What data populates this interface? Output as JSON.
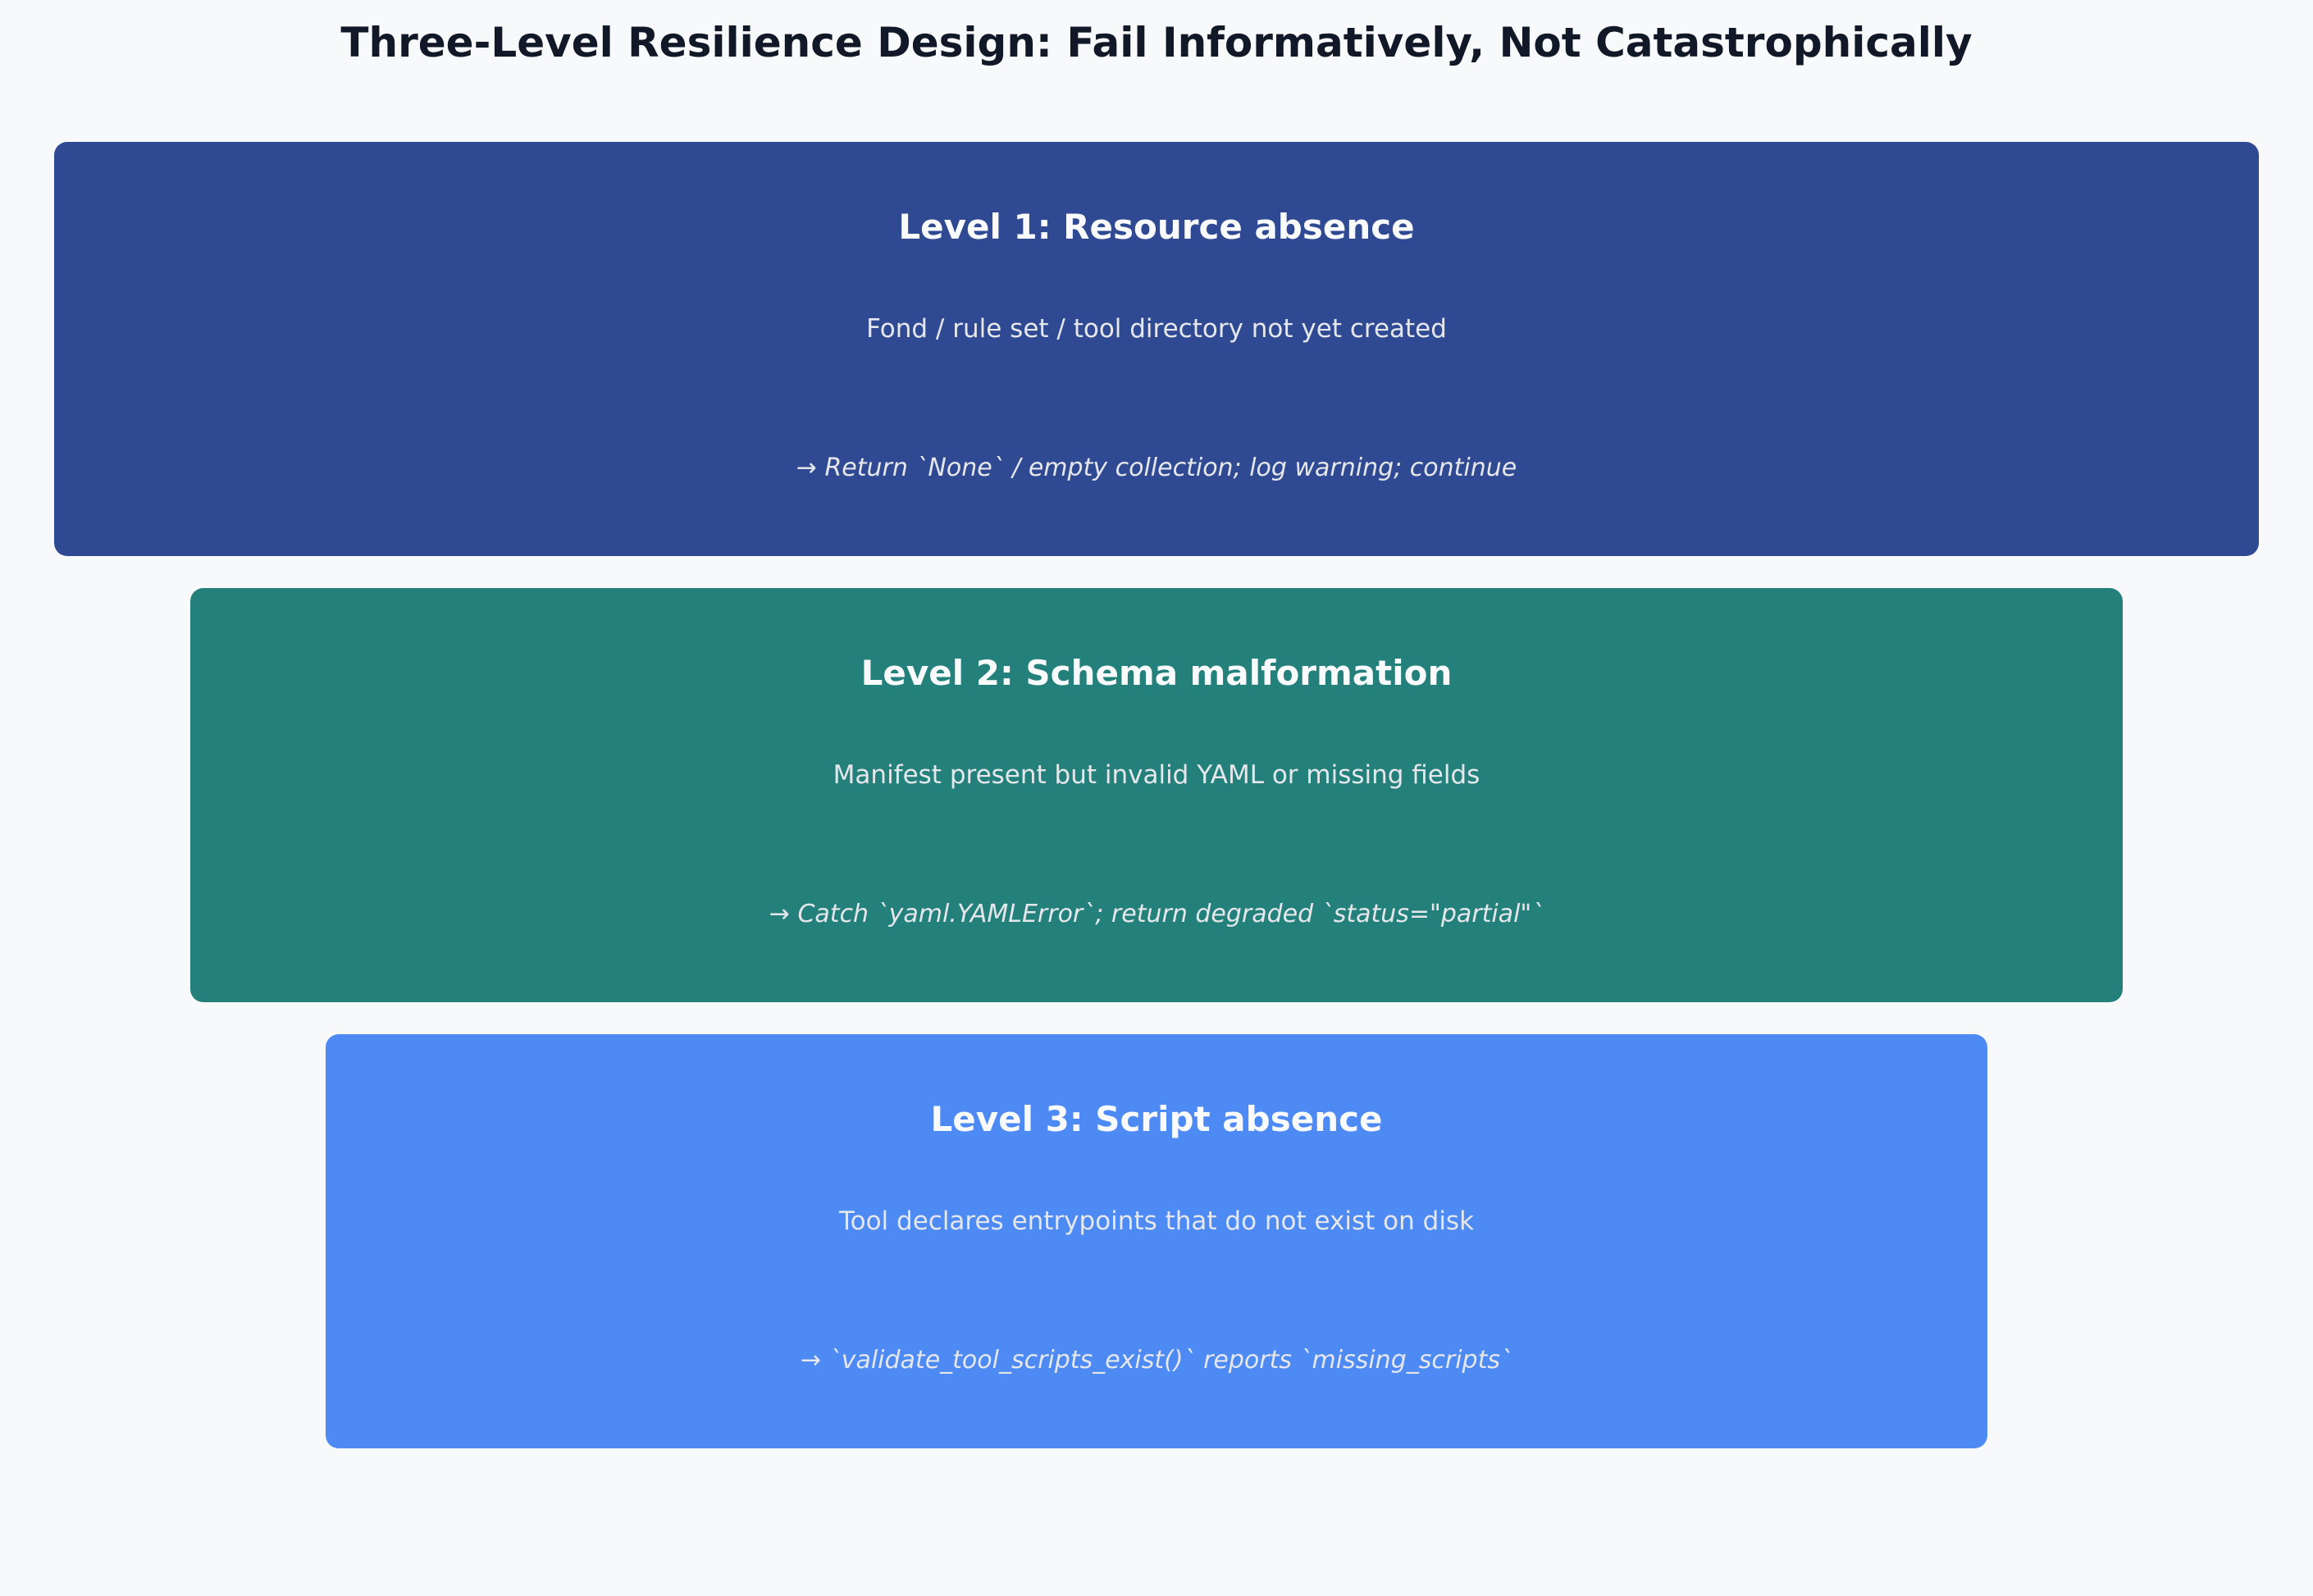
{
  "title": "Three-Level Resilience Design: Fail Informatively, Not Catastrophically",
  "levels": [
    {
      "heading": "Level 1: Resource absence",
      "description": "Fond / rule set / tool directory not yet created",
      "action": "→ Return `None` / empty collection; log warning; continue",
      "color": "#2f4a93"
    },
    {
      "heading": "Level 2: Schema malformation",
      "description": "Manifest present but invalid YAML or missing fields",
      "action": "→ Catch `yaml.YAMLError`; return degraded `status=\"partial\"`",
      "color": "#23807a"
    },
    {
      "heading": "Level 3: Script absence",
      "description": "Tool declares entrypoints that do not exist on disk",
      "action": "→ `validate_tool_scripts_exist()` reports `missing_scripts`",
      "color": "#4d8af4"
    }
  ]
}
